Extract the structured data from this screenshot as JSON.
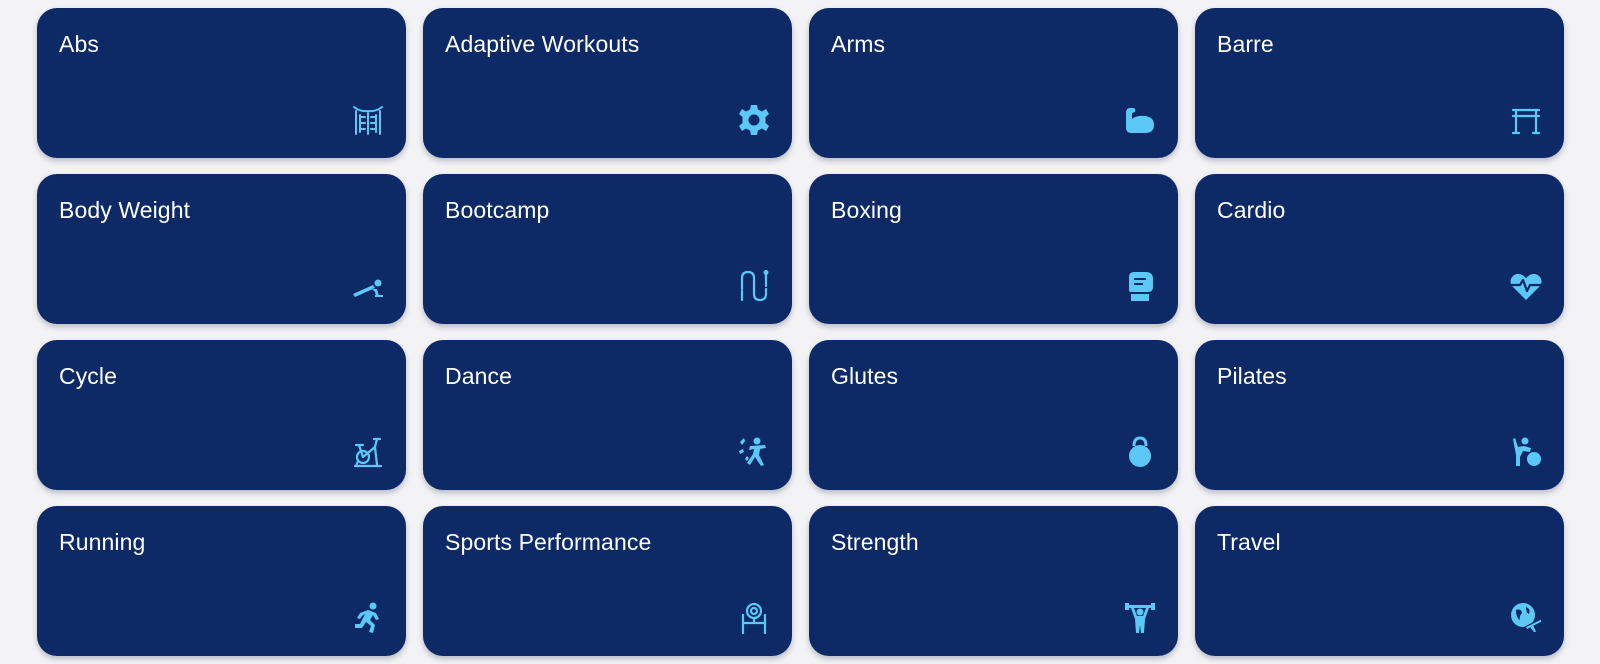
{
  "accent_color": "#5cc8f5",
  "card_color": "#0d2a66",
  "background_color": "#f3f3f6",
  "categories": [
    {
      "label": "Abs",
      "icon": "abs-icon"
    },
    {
      "label": "Adaptive Workouts",
      "icon": "gear-icon"
    },
    {
      "label": "Arms",
      "icon": "flexed-arm-icon"
    },
    {
      "label": "Barre",
      "icon": "barre-icon"
    },
    {
      "label": "Body Weight",
      "icon": "plank-icon"
    },
    {
      "label": "Bootcamp",
      "icon": "jump-rope-icon"
    },
    {
      "label": "Boxing",
      "icon": "boxing-glove-icon"
    },
    {
      "label": "Cardio",
      "icon": "heart-pulse-icon"
    },
    {
      "label": "Cycle",
      "icon": "stationary-bike-icon"
    },
    {
      "label": "Dance",
      "icon": "dancer-icon"
    },
    {
      "label": "Glutes",
      "icon": "kettlebell-icon"
    },
    {
      "label": "Pilates",
      "icon": "pilates-ball-icon"
    },
    {
      "label": "Running",
      "icon": "runner-icon"
    },
    {
      "label": "Sports Performance",
      "icon": "speed-ladder-icon"
    },
    {
      "label": "Strength",
      "icon": "weightlifter-icon"
    },
    {
      "label": "Travel",
      "icon": "globe-plane-icon"
    }
  ]
}
